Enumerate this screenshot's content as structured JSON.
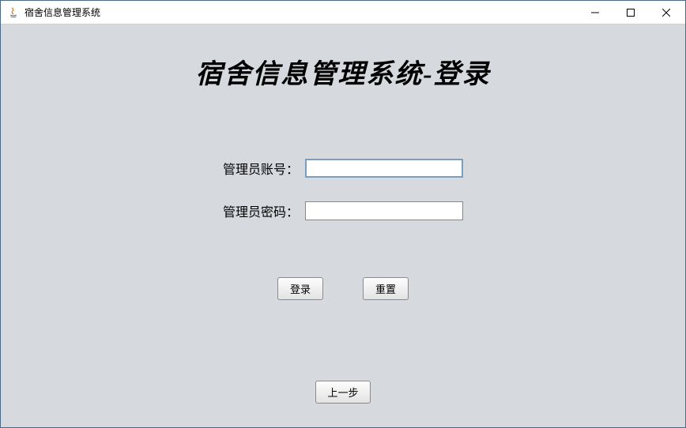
{
  "window": {
    "title": "宿舍信息管理系统"
  },
  "heading": "宿舍信息管理系统-登录",
  "form": {
    "username_label": "管理员账号：",
    "username_value": "",
    "password_label": "管理员密码：",
    "password_value": ""
  },
  "buttons": {
    "login": "登录",
    "reset": "重置",
    "back": "上一步"
  }
}
